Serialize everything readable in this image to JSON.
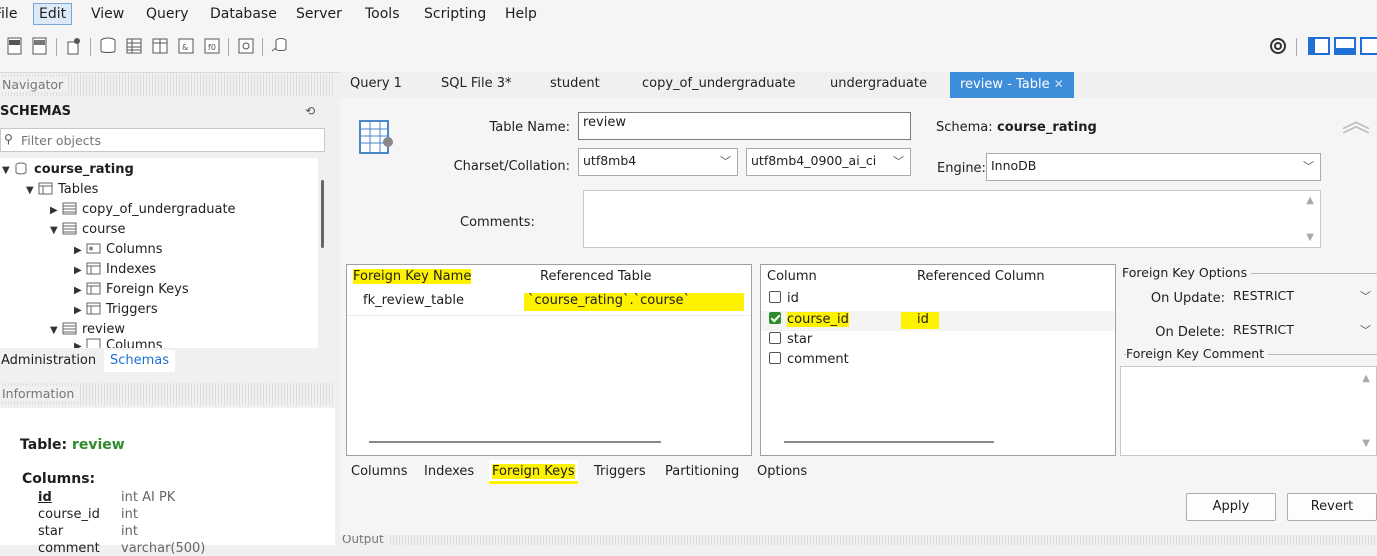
{
  "menu": [
    "File",
    "Edit",
    "View",
    "Query",
    "Database",
    "Server",
    "Tools",
    "Scripting",
    "Help"
  ],
  "navigator": {
    "header": "Navigator",
    "schemas_title": "SCHEMAS",
    "filter_placeholder": "Filter objects",
    "tree": {
      "schema": "course_rating",
      "tables": "Tables",
      "t1": "copy_of_undergraduate",
      "t2": "course",
      "columns": "Columns",
      "indexes": "Indexes",
      "fks": "Foreign Keys",
      "triggers": "Triggers",
      "t3": "review",
      "columns2": "Columns"
    },
    "tabs": [
      "Administration",
      "Schemas"
    ]
  },
  "information": {
    "header": "Information",
    "table_label": "Table:",
    "table_name": "review",
    "columns_label": "Columns:",
    "columns": [
      {
        "name": "id",
        "type": "int AI PK"
      },
      {
        "name": "course_id",
        "type": "int"
      },
      {
        "name": "star",
        "type": "int"
      },
      {
        "name": "comment",
        "type": "varchar(500)"
      }
    ]
  },
  "editor_tabs": [
    "Query 1",
    "SQL File 3*",
    "student",
    "copy_of_undergraduate",
    "undergraduate",
    "review - Table"
  ],
  "table_editor": {
    "table_name_label": "Table Name:",
    "table_name": "review",
    "schema_label": "Schema:",
    "schema": "course_rating",
    "charset_label": "Charset/Collation:",
    "charset": "utf8mb4",
    "collation": "utf8mb4_0900_ai_ci",
    "engine_label": "Engine:",
    "engine": "InnoDB",
    "comments_label": "Comments:"
  },
  "fk_table": {
    "headers": [
      "Foreign Key Name",
      "Referenced Table"
    ],
    "rows": [
      {
        "name": "fk_review_table",
        "ref": "`course_rating`.`course`"
      }
    ]
  },
  "col_table": {
    "headers": [
      "Column",
      "Referenced Column"
    ],
    "rows": [
      {
        "name": "id",
        "checked": false,
        "ref": ""
      },
      {
        "name": "course_id",
        "checked": true,
        "ref": "id"
      },
      {
        "name": "star",
        "checked": false,
        "ref": ""
      },
      {
        "name": "comment",
        "checked": false,
        "ref": ""
      }
    ]
  },
  "fk_options": {
    "title": "Foreign Key Options",
    "on_update_label": "On Update:",
    "on_update": "RESTRICT",
    "on_delete_label": "On Delete:",
    "on_delete": "RESTRICT",
    "comment_title": "Foreign Key Comment"
  },
  "bottom_tabs": [
    "Columns",
    "Indexes",
    "Foreign Keys",
    "Triggers",
    "Partitioning",
    "Options"
  ],
  "buttons": {
    "apply": "Apply",
    "revert": "Revert"
  },
  "output_label": "Output"
}
